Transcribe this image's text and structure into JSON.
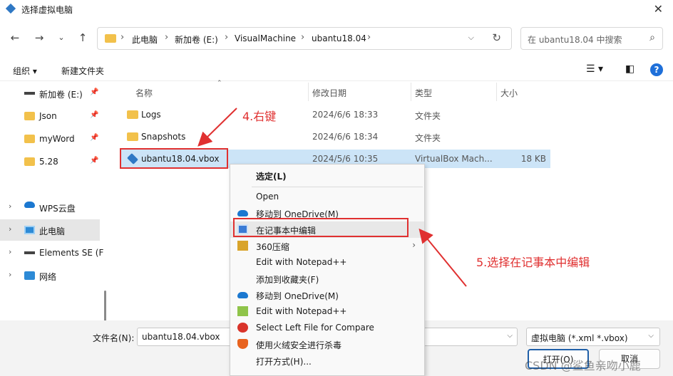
{
  "window": {
    "title": "选择虚拟电脑"
  },
  "nav": {
    "crumbs": [
      "此电脑",
      "新加卷 (E:)",
      "VisualMachine",
      "ubantu18.04"
    ],
    "search_placeholder": "在 ubantu18.04 中搜索"
  },
  "toolbar": {
    "organize": "组织",
    "new_folder": "新建文件夹"
  },
  "sidebar": {
    "pinned": [
      {
        "label": "新加卷 (E:)",
        "icon": "drive-icon"
      },
      {
        "label": "Json",
        "icon": "folder-icon"
      },
      {
        "label": "myWord",
        "icon": "folder-icon"
      },
      {
        "label": "5.28",
        "icon": "folder-icon"
      }
    ],
    "tree": [
      {
        "label": "WPS云盘",
        "icon": "cloud-icon"
      },
      {
        "label": "此电脑",
        "icon": "computer-icon",
        "selected": true
      },
      {
        "label": "Elements SE (F",
        "icon": "drive-icon"
      },
      {
        "label": "网络",
        "icon": "network-icon"
      }
    ]
  },
  "columns": {
    "name": "名称",
    "modified": "修改日期",
    "type": "类型",
    "size": "大小"
  },
  "files": [
    {
      "name": "Logs",
      "modified": "2024/6/6 18:33",
      "type": "文件夹",
      "size": ""
    },
    {
      "name": "Snapshots",
      "modified": "2024/6/6 18:34",
      "type": "文件夹",
      "size": ""
    },
    {
      "name": "ubantu18.04.vbox",
      "modified": "2024/5/6 10:35",
      "type": "VirtualBox Mach...",
      "size": "18 KB"
    }
  ],
  "context_menu": {
    "select": "选定(L)",
    "items": [
      "Open",
      "移动到 OneDrive(M)",
      "在记事本中编辑",
      "360压缩",
      "Edit with Notepad++",
      "添加到收藏夹(F)",
      "移动到 OneDrive(M)",
      "Edit with Notepad++",
      "Select Left File for Compare",
      "使用火绒安全进行杀毒",
      "打开方式(H)..."
    ]
  },
  "bottom": {
    "filename_label": "文件名(N):",
    "filename_value": "ubantu18.04.vbox",
    "filetype_value": "虚拟电脑 (*.xml *.vbox)",
    "open_button": "打开(O)",
    "cancel_button": "取消"
  },
  "annotations": {
    "step4": "4.右键",
    "step5": "5.选择在记事本中编辑",
    "watermark": "CSDN @鲨鱼亲吻小鹿"
  },
  "colors": {
    "annotation": "#e03030",
    "selection": "#cce4f7",
    "accent": "#1e6fd9"
  }
}
